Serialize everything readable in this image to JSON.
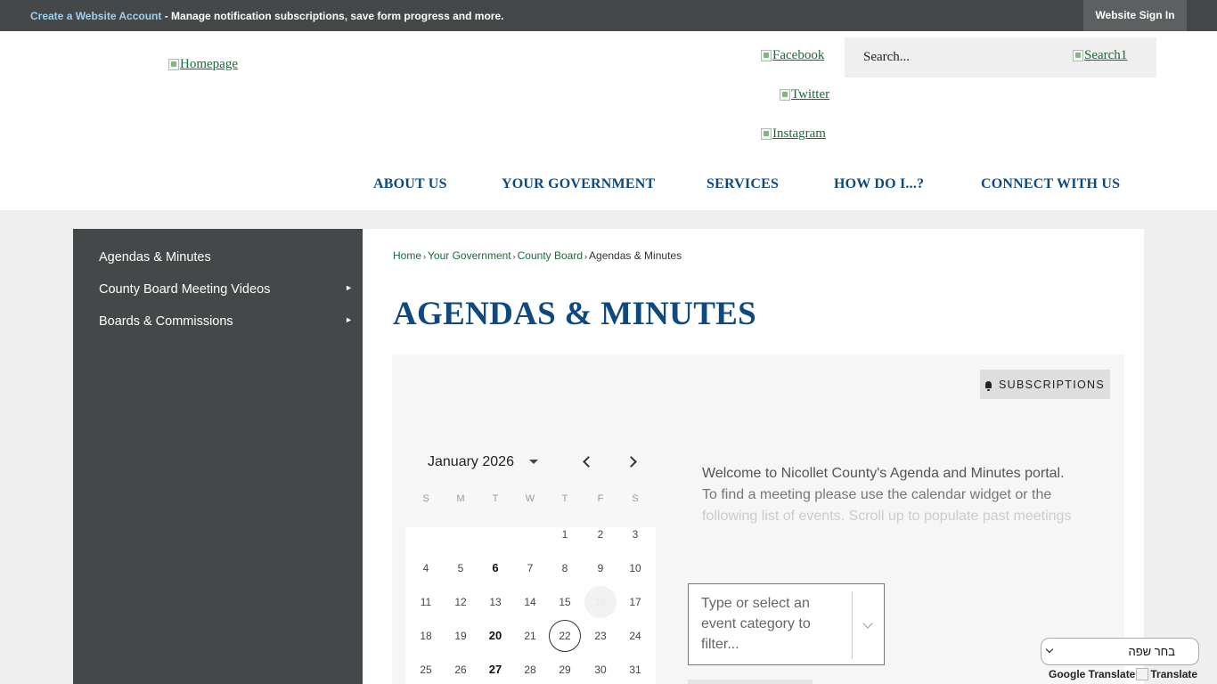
{
  "topbar": {
    "create_account_link": "Create a Website Account",
    "message": " - Manage notification subscriptions, save form progress and more.",
    "sign_in": "Website Sign In"
  },
  "header": {
    "logo_alt": "Homepage",
    "social": {
      "facebook": "Facebook",
      "twitter": "Twitter",
      "instagram": "Instagram"
    },
    "search": {
      "placeholder": "Search...",
      "button_alt": "Search1"
    }
  },
  "nav": {
    "items": [
      "ABOUT US",
      "YOUR GOVERNMENT",
      "SERVICES",
      "HOW DO I...?",
      "CONNECT WITH US"
    ]
  },
  "sidebar": {
    "items": [
      {
        "label": "Agendas & Minutes",
        "has_submenu": false
      },
      {
        "label": "County Board Meeting Videos",
        "has_submenu": true
      },
      {
        "label": "Boards & Commissions",
        "has_submenu": true
      }
    ],
    "arrow_glyph": "►"
  },
  "breadcrumb": {
    "items": [
      "Home",
      "Your Government",
      "County Board",
      "Agendas & Minutes"
    ],
    "separator": "›"
  },
  "page": {
    "title": "AGENDAS & MINUTES",
    "subscriptions_label": "SUBSCRIPTIONS"
  },
  "calendar": {
    "month_label": "January 2026",
    "weekdays": [
      "S",
      "M",
      "T",
      "W",
      "T",
      "F",
      "S"
    ],
    "weeks": [
      [
        "",
        "",
        "",
        "",
        "1",
        "2",
        "3"
      ],
      [
        "4",
        "5",
        "6",
        "7",
        "8",
        "9",
        "10"
      ],
      [
        "11",
        "12",
        "13",
        "14",
        "15",
        "16",
        "17"
      ],
      [
        "18",
        "19",
        "20",
        "21",
        "22",
        "23",
        "24"
      ],
      [
        "25",
        "26",
        "27",
        "28",
        "29",
        "30",
        "31"
      ]
    ],
    "event_days": [
      "6",
      "20",
      "27"
    ],
    "selected_day": "22",
    "highlighted_day": "16"
  },
  "welcome": {
    "line1": "Welcome to Nicollet County's Agenda and Minutes portal.",
    "line2": "To find a meeting please use the calendar widget or the",
    "line3": "following list of events. Scroll up to populate past meetings"
  },
  "filter": {
    "placeholder": "Type or select an event category to filter..."
  },
  "translate": {
    "language_select": "בחר שפה",
    "powered_by": "Google Translate",
    "translate_alt": "Translate"
  },
  "colors": {
    "topbar_bg": "#444848",
    "nav_text": "#0e4a80",
    "link_green": "#1a6b3a",
    "sidebar_bg": "#444848"
  }
}
